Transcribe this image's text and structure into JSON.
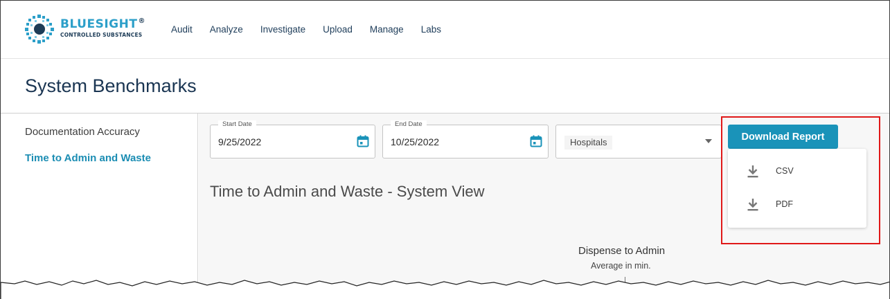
{
  "brand": {
    "name": "BLUESIGHT",
    "registered": "®",
    "subtitle": "CONTROLLED SUBSTANCES",
    "colors": {
      "blue": "#2c9fc9",
      "navy": "#1d3c57"
    }
  },
  "nav": {
    "items": [
      {
        "label": "Audit"
      },
      {
        "label": "Analyze"
      },
      {
        "label": "Investigate"
      },
      {
        "label": "Upload"
      },
      {
        "label": "Manage"
      },
      {
        "label": "Labs"
      }
    ]
  },
  "page": {
    "title": "System Benchmarks"
  },
  "sidebar": {
    "items": [
      {
        "label": "Documentation Accuracy",
        "active": false
      },
      {
        "label": "Time to Admin and Waste",
        "active": true
      }
    ]
  },
  "filters": {
    "start_date": {
      "label": "Start Date",
      "value": "9/25/2022",
      "icon": "calendar-icon"
    },
    "end_date": {
      "label": "End Date",
      "value": "10/25/2022",
      "icon": "calendar-icon"
    },
    "hospitals": {
      "value": "Hospitals",
      "icon": "caret-down-icon"
    }
  },
  "download": {
    "button_label": "Download Report",
    "options": [
      {
        "label": "CSV",
        "icon": "download-icon"
      },
      {
        "label": "PDF",
        "icon": "download-icon"
      }
    ],
    "accent": "#1a93b9",
    "highlight_color": "#e01818"
  },
  "report": {
    "title": "Time to Admin and Waste - System View",
    "chart_title": "Dispense to Admin",
    "chart_subtitle": "Average in min."
  }
}
